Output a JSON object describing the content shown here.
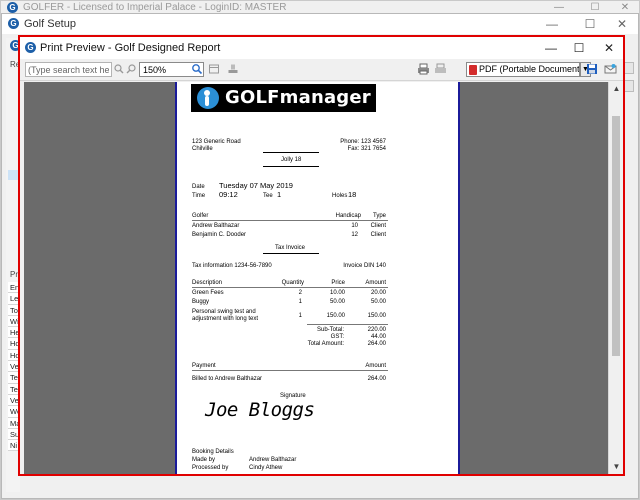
{
  "main_window": {
    "title": "GOLFER - Licensed to Imperial Palace - LoginID: MASTER",
    "controls": {
      "minimize": "—",
      "maximize": "☐",
      "close": "✕"
    }
  },
  "setup_window": {
    "title": "Golf Setup",
    "controls": {
      "minimize": "—",
      "maximize": "☐",
      "close": "✕"
    },
    "partial_labels": {
      "re": "Re",
      "pr": "Pr"
    },
    "list_items": [
      "En",
      "Le",
      "To",
      "Wi",
      "He",
      "Ho",
      "Ho",
      "Ve",
      "Te",
      "Te",
      "Ve",
      "We",
      "Ma",
      "Su",
      "Ni"
    ]
  },
  "preview_window": {
    "title": "Print Preview - Golf Designed Report",
    "controls": {
      "minimize": "—",
      "maximize": "☐",
      "close": "✕"
    }
  },
  "toolbar": {
    "search_placeholder": "(Type search text here)",
    "zoom_value": "150%",
    "export_format": "PDF (Portable Document Format)",
    "icons": [
      "find-next-icon",
      "find-previous-icon",
      "search-icon",
      "page-setup-icon",
      "print-icon",
      "print-icon-secondary",
      "save-icon",
      "email-icon"
    ]
  },
  "report": {
    "brand": "GOLFmanager",
    "address_line1": "123 Generic Road",
    "address_line2": "Chilville",
    "phone": "Phone: 123 4567",
    "fax": "Fax: 321 7654",
    "heading": "Jolly 18",
    "date_label": "Date",
    "date_value": "Tuesday 07 May 2019",
    "time_label": "Time",
    "time_value": "09:12",
    "tee_label": "Tee",
    "tee_value": "1",
    "holes_label": "Holes",
    "holes_value": "18",
    "golfers_header": {
      "golfer": "Golfer",
      "handicap": "Handicap",
      "type": "Type"
    },
    "golfers": [
      {
        "name": "Andrew Balthazar",
        "handicap": "10",
        "type": "Client"
      },
      {
        "name": "Benjamin C. Dooder",
        "handicap": "12",
        "type": "Client"
      }
    ],
    "tax_invoice_title": "Tax Invoice",
    "tax_info": "Tax information 1234-56-7890",
    "invoice_no": "Invoice DIN 140",
    "items_header": {
      "description": "Description",
      "quantity": "Quantity",
      "price": "Price",
      "amount": "Amount"
    },
    "items": [
      {
        "description": "Green Fees",
        "quantity": "2",
        "price": "10.00",
        "amount": "20.00"
      },
      {
        "description": "Buggy",
        "quantity": "1",
        "price": "50.00",
        "amount": "50.00"
      },
      {
        "description": "Personal swing test and adjustment with long text",
        "quantity": "1",
        "price": "150.00",
        "amount": "150.00"
      }
    ],
    "subtotal_label": "Sub-Total:",
    "subtotal_value": "220.00",
    "gst_label": "GST:",
    "gst_value": "44.00",
    "total_label": "Total Amount:",
    "total_value": "264.00",
    "payment_label": "Payment",
    "payment_amount_label": "Amount",
    "payment_line": "Billed to Andrew Balthazar",
    "payment_value": "264.00",
    "signature_label": "Signature",
    "signature": "Joe Bloggs",
    "booking_details_label": "Booking Details",
    "made_by_label": "Made by",
    "made_by_value": "Andrew Balthazar",
    "processed_by_label": "Processed by",
    "processed_by_value": "Cindy Athew"
  },
  "colors": {
    "highlight_border": "#e00000",
    "canvas_bg": "#6b6b6b",
    "page_edge": "#1b1b9a",
    "logo_bg": "#000000",
    "logo_mark": "#2b8fd6"
  }
}
